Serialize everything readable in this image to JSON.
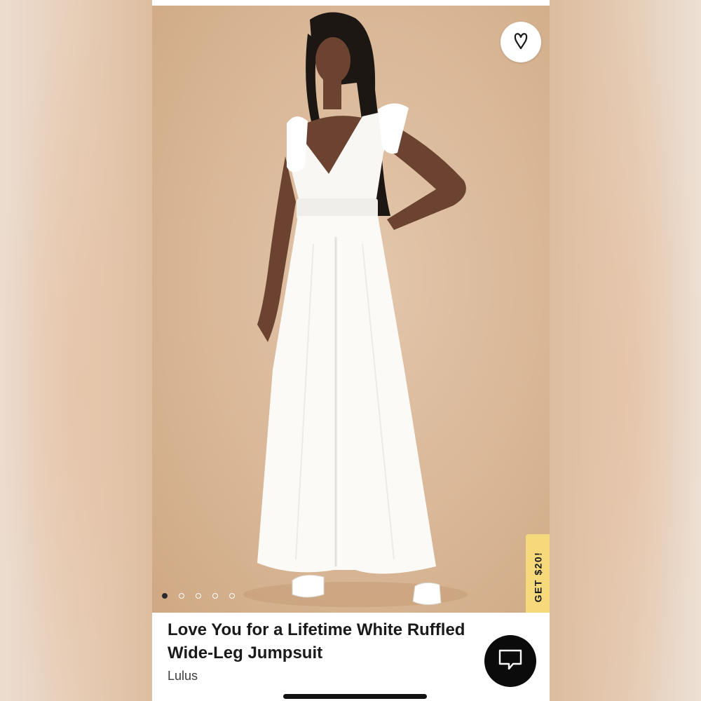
{
  "product": {
    "title_line1": "Love You for a Lifetime White Ruffled",
    "title_line2": "Wide-Leg Jumpsuit",
    "brand": "Lulus"
  },
  "promo": {
    "label": "GET $20!"
  },
  "gallery": {
    "image_count": 5,
    "active_index": 0
  },
  "icons": {
    "favorite": "heart-outline-icon",
    "chat": "chat-bubble-icon"
  },
  "colors": {
    "promo_tab": "#f6d97a",
    "chat_button": "#0b0b0b",
    "photo_background": "#d9b797"
  }
}
